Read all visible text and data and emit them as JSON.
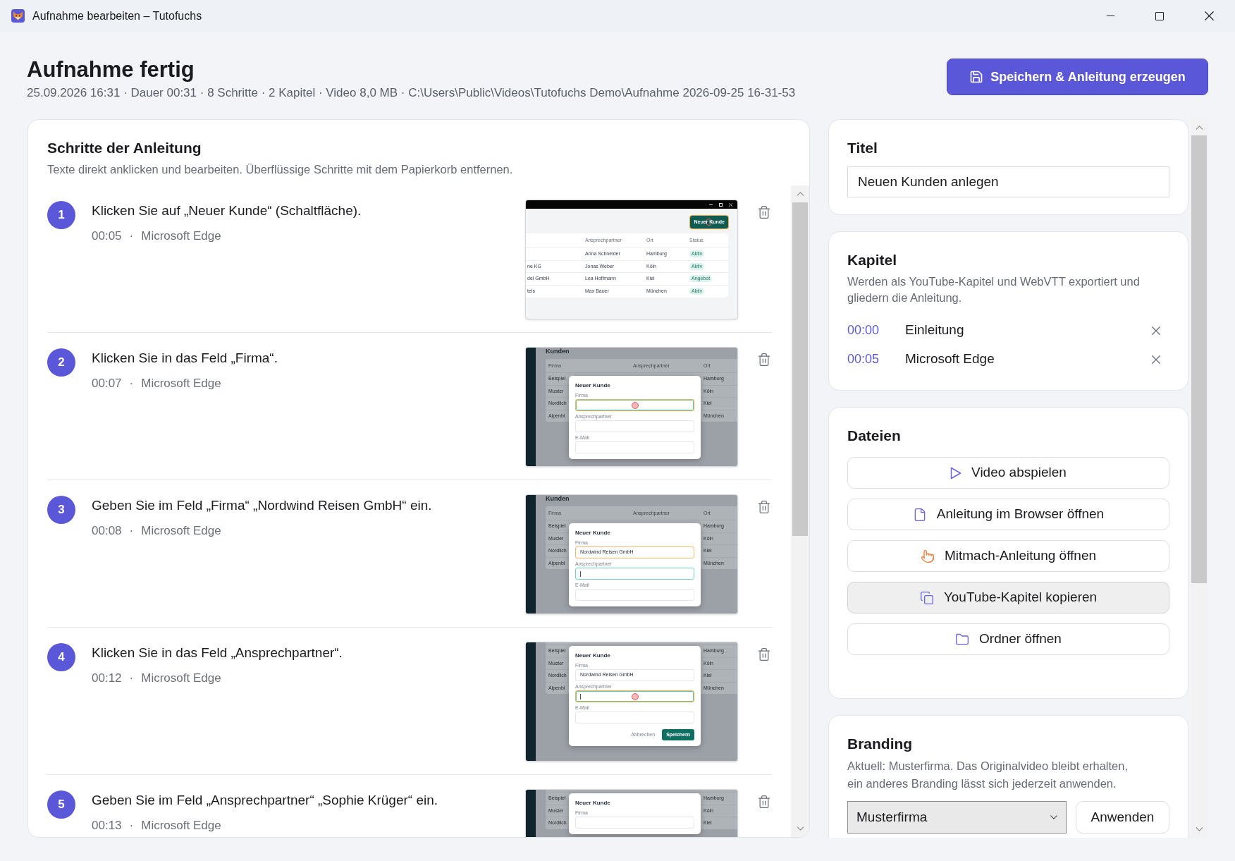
{
  "window": {
    "title": "Aufnahme bearbeiten – Tutofuchs"
  },
  "header": {
    "title": "Aufnahme fertig",
    "details": "25.09.2026 16:31 · Dauer 00:31 · 8 Schritte · 2 Kapitel · Video 8,0 MB · C:\\Users\\Public\\Videos\\Tutofuchs Demo\\Aufnahme 2026-09-25 16-31-53",
    "save_button": "Speichern & Anleitung erzeugen"
  },
  "steps_panel": {
    "title": "Schritte der Anleitung",
    "hint": "Texte direkt anklicken und bearbeiten. Überflüssige Schritte mit dem Papierkorb entfernen.",
    "steps": [
      {
        "number": "1",
        "text": "Klicken Sie auf „Neuer Kunde“ (Schaltfläche).",
        "time": "00:05",
        "separator": "·",
        "app": "Microsoft Edge",
        "screenshot": {
          "kind": "list",
          "button": {
            "label": "Neuer Kunde",
            "highlighted": true,
            "clicked": true
          },
          "columns": [
            "Ansprechpartner",
            "Ort",
            "Status"
          ],
          "rows": [
            {
              "contact": "Anna Schneider",
              "city": "Hamburg",
              "status": "Aktiv"
            },
            {
              "column_1": "ne KG",
              "contact": "Jonas Weber",
              "city": "Köln",
              "status": "Aktiv"
            },
            {
              "column_1": "del GmbH",
              "contact": "Lea Hoffmann",
              "city": "Kiel",
              "status": "Angebot"
            },
            {
              "column_1": "tels",
              "contact": "Max Bauer",
              "city": "München",
              "status": "Aktiv"
            }
          ]
        }
      },
      {
        "number": "2",
        "text": "Klicken Sie in das Feld „Firma“.",
        "time": "00:07",
        "separator": "·",
        "app": "Microsoft Edge",
        "screenshot": {
          "kind": "dialog",
          "heading": "Kunden",
          "columns": [
            "Firma",
            "Ansprechpartner",
            "Ort"
          ],
          "rows": [
            {
              "company": "Beispiel",
              "city": "Hamburg"
            },
            {
              "company": "Muster",
              "city": "Köln"
            },
            {
              "company": "Nordlich",
              "city": "Kiel"
            },
            {
              "company": "Alpenbl",
              "city": "München"
            }
          ],
          "dialog": {
            "title": "Neuer Kunde",
            "fields": [
              {
                "label": "Firma",
                "highlighted": true,
                "focused": true,
                "clicked": true,
                "cursor": false
              },
              {
                "label": "Ansprechpartner",
                "highlighted": false,
                "focused": false,
                "clicked": false,
                "cursor": false
              },
              {
                "label": "E-Mail",
                "highlighted": false,
                "focused": false,
                "clicked": false,
                "cursor": false
              }
            ]
          }
        }
      },
      {
        "number": "3",
        "text": "Geben Sie im Feld „Firma“ „Nordwind Reisen GmbH“ ein.",
        "time": "00:08",
        "separator": "·",
        "app": "Microsoft Edge",
        "screenshot": {
          "kind": "dialog",
          "heading": "Kunden",
          "columns": [
            "Firma",
            "Ansprechpartner",
            "Ort"
          ],
          "rows": [
            {
              "company": "Beispiel",
              "city": "Hamburg"
            },
            {
              "company": "Muster",
              "city": "Köln"
            },
            {
              "company": "Nordlich",
              "city": "Kiel"
            },
            {
              "company": "Alpenbl",
              "city": "München"
            }
          ],
          "dialog": {
            "title": "Neuer Kunde",
            "fields": [
              {
                "label": "Firma",
                "value": "Nordwind Reisen GmbH",
                "highlighted": true,
                "focused": false,
                "clicked": false,
                "cursor": false
              },
              {
                "label": "Ansprechpartner",
                "highlighted": false,
                "focused": true,
                "clicked": false,
                "cursor": true
              },
              {
                "label": "E-Mail",
                "highlighted": false,
                "focused": false,
                "clicked": false,
                "cursor": false
              }
            ]
          }
        }
      },
      {
        "number": "4",
        "text": "Klicken Sie in das Feld „Ansprechpartner“.",
        "time": "00:12",
        "separator": "·",
        "app": "Microsoft Edge",
        "screenshot": {
          "kind": "dialog",
          "rows": [
            {
              "company": "Beispiel",
              "city": "Hamburg"
            },
            {
              "company": "Muster",
              "city": "Köln"
            },
            {
              "company": "Nordlich",
              "city": "Kiel"
            },
            {
              "company": "Alpenbl",
              "city": "München"
            }
          ],
          "dialog": {
            "title": "Neuer Kunde",
            "fields": [
              {
                "label": "Firma",
                "value": "Nordwind Reisen GmbH",
                "highlighted": false,
                "focused": false,
                "clicked": false,
                "cursor": false
              },
              {
                "label": "Ansprechpartner",
                "highlighted": true,
                "focused": true,
                "clicked": true,
                "cursor": true
              },
              {
                "label": "E-Mail",
                "highlighted": false,
                "focused": false,
                "clicked": false,
                "cursor": false
              }
            ],
            "buttons": [
              {
                "label": "Abbrechen",
                "kind": "secondary"
              },
              {
                "label": "Speichern",
                "kind": "primary"
              }
            ]
          }
        }
      },
      {
        "number": "5",
        "text": "Geben Sie im Feld „Ansprechpartner“ „Sophie Krüger“ ein.",
        "time": "00:13",
        "separator": "·",
        "app": "Microsoft Edge",
        "screenshot": {
          "kind": "dialog",
          "rows": [
            {
              "company": "Beispiel",
              "city": "Hamburg"
            },
            {
              "company": "Muster",
              "city": "Köln"
            },
            {
              "company": "Nordlich",
              "city": "Kiel"
            }
          ],
          "dialog": {
            "title": "Neuer Kunde",
            "fields": [
              {
                "label": "Firma",
                "highlighted": false,
                "focused": false,
                "clicked": false,
                "cursor": false
              }
            ]
          }
        }
      }
    ]
  },
  "title_panel": {
    "title": "Titel",
    "value": "Neuen Kunden anlegen"
  },
  "chapters_panel": {
    "title": "Kapitel",
    "description": "Werden als YouTube-Kapitel und WebVTT exportiert und gliedern die Anleitung.",
    "chapters": [
      {
        "time": "00:00",
        "name": "Einleitung"
      },
      {
        "time": "00:05",
        "name": "Microsoft Edge"
      }
    ]
  },
  "files_panel": {
    "title": "Dateien",
    "buttons": [
      {
        "label": "Video abspielen",
        "kind": "play",
        "highlighted": false
      },
      {
        "label": "Anleitung im Browser öffnen",
        "kind": "document",
        "highlighted": false
      },
      {
        "label": "Mitmach-Anleitung öffnen",
        "kind": "pointer",
        "highlighted": false
      },
      {
        "label": "YouTube-Kapitel kopieren",
        "kind": "copy",
        "highlighted": true
      },
      {
        "label": "Ordner öffnen",
        "kind": "folder",
        "highlighted": false
      }
    ]
  },
  "branding_panel": {
    "title": "Branding",
    "description": "Aktuell: Musterfirma. Das Originalvideo bleibt erhalten, ein anderes Branding lässt sich jederzeit anwenden.",
    "select": {
      "value": "Musterfirma"
    },
    "apply_button": "Anwenden"
  }
}
